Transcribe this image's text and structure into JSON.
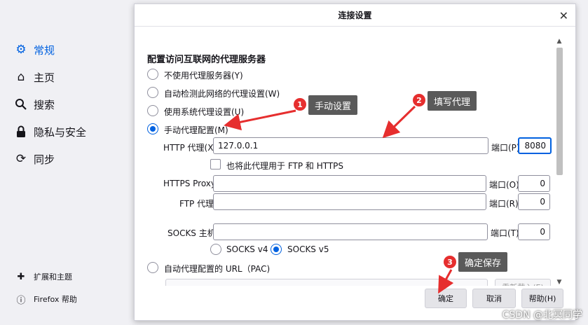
{
  "sidebar": {
    "items": [
      {
        "label": "常规",
        "icon": "gear-icon"
      },
      {
        "label": "主页",
        "icon": "home-icon"
      },
      {
        "label": "搜索",
        "icon": "search-icon"
      },
      {
        "label": "隐私与安全",
        "icon": "lock-icon"
      },
      {
        "label": "同步",
        "icon": "sync-icon"
      }
    ],
    "footer": [
      {
        "label": "扩展和主题",
        "icon": "puzzle-icon"
      },
      {
        "label": "Firefox 帮助",
        "icon": "help-icon"
      }
    ]
  },
  "dialog": {
    "title": "连接设置",
    "heading": "配置访问互联网的代理服务器",
    "options": {
      "no_proxy": "不使用代理服务器(Y)",
      "auto_detect": "自动检测此网络的代理设置(W)",
      "system": "使用系统代理设置(U)",
      "manual": "手动代理配置(M)",
      "pac": "自动代理配置的 URL（PAC)"
    },
    "http": {
      "label": "HTTP 代理(X)",
      "value": "127.0.0.1",
      "port_label": "端口(P)",
      "port": "8080"
    },
    "also_use": "也将此代理用于 FTP 和 HTTPS",
    "https": {
      "label": "HTTPS Proxy",
      "value": "",
      "port_label": "端口(O)",
      "port": "0"
    },
    "ftp": {
      "label": "FTP 代理",
      "value": "",
      "port_label": "端口(R)",
      "port": "0"
    },
    "socks": {
      "label": "SOCKS 主机",
      "value": "",
      "port_label": "端口(T)",
      "port": "0"
    },
    "socks_v4": "SOCKS v4",
    "socks_v5": "SOCKS v5",
    "reload": "重新载入(E)",
    "buttons": {
      "ok": "确定",
      "cancel": "取消",
      "help": "帮助(H)"
    }
  },
  "annotations": [
    {
      "number": "1",
      "text": "手动设置"
    },
    {
      "number": "2",
      "text": "填写代理"
    },
    {
      "number": "3",
      "text": "确定保存"
    }
  ],
  "watermark": "CSDN @北冥同学",
  "colors": {
    "accent": "#0061e0",
    "callout_bg": "#5a5a5a",
    "badge": "#e62e2e",
    "arrow": "#e62e2e"
  }
}
